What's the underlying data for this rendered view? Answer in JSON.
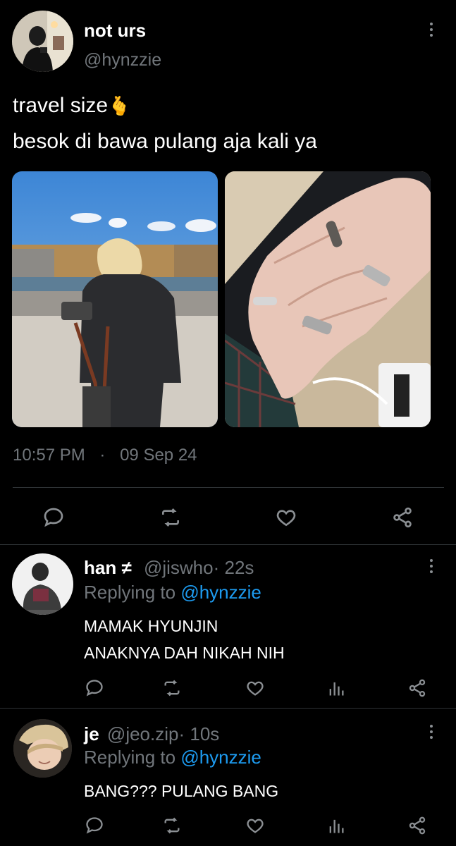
{
  "main_tweet": {
    "display_name": "not urs",
    "handle": "@hynzzie",
    "text_line1": "travel size",
    "emoji": "🫰",
    "text_line2": "besok di bawa pulang aja kali ya",
    "time": "10:57 PM",
    "separator": "·",
    "date": "09 Sep 24"
  },
  "replies": [
    {
      "display_name": "han ≠",
      "handle": "@jiswho",
      "age": "· 22s",
      "replying_prefix": "Replying to",
      "replying_handle": "@hynzzie",
      "text_line1": "MAMAK HYUNJIN",
      "text_line2": "ANAKNYA DAH NIKAH NIH"
    },
    {
      "display_name": "je",
      "handle": "@jeo.zip",
      "age": "· 10s",
      "replying_prefix": "Replying to",
      "replying_handle": "@hynzzie",
      "text_line1": "BANG??? PULANG BANG"
    }
  ],
  "colors": {
    "background": "#000000",
    "link": "#1d9bf0",
    "muted": "#71767b",
    "divider": "#2f3336"
  },
  "icons": [
    "more-vertical-icon",
    "reply-icon",
    "retweet-icon",
    "like-icon",
    "views-icon",
    "share-icon"
  ]
}
